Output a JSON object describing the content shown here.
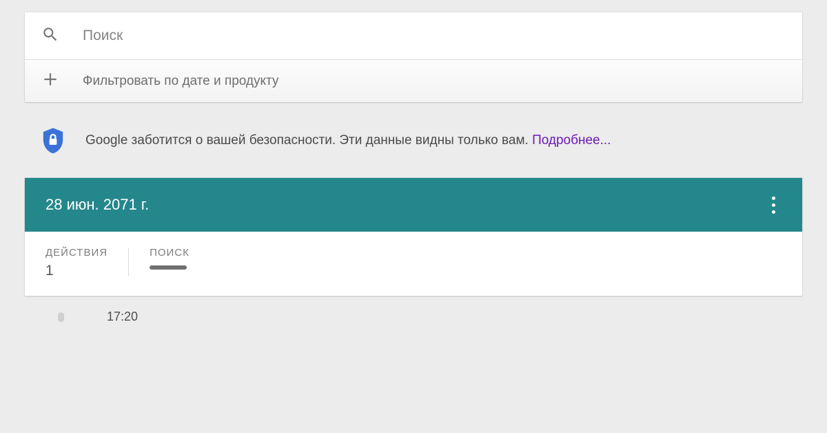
{
  "search": {
    "placeholder": "Поиск",
    "value": ""
  },
  "filter": {
    "label": "Фильтровать по дате и продукту"
  },
  "privacy": {
    "text": "Google заботится о вашей безопасности. Эти данные видны только вам. ",
    "link_label": "Подробнее..."
  },
  "activity": {
    "date_label": "28 июн. 2071 г.",
    "stats": {
      "actions_label": "ДЕЙСТВИЯ",
      "actions_value": "1",
      "search_label": "ПОИСК"
    }
  },
  "timeline": {
    "time": "17:20"
  },
  "colors": {
    "header_bg": "#24878c",
    "shield": "#3a73d8",
    "link": "#6a1bb8"
  }
}
